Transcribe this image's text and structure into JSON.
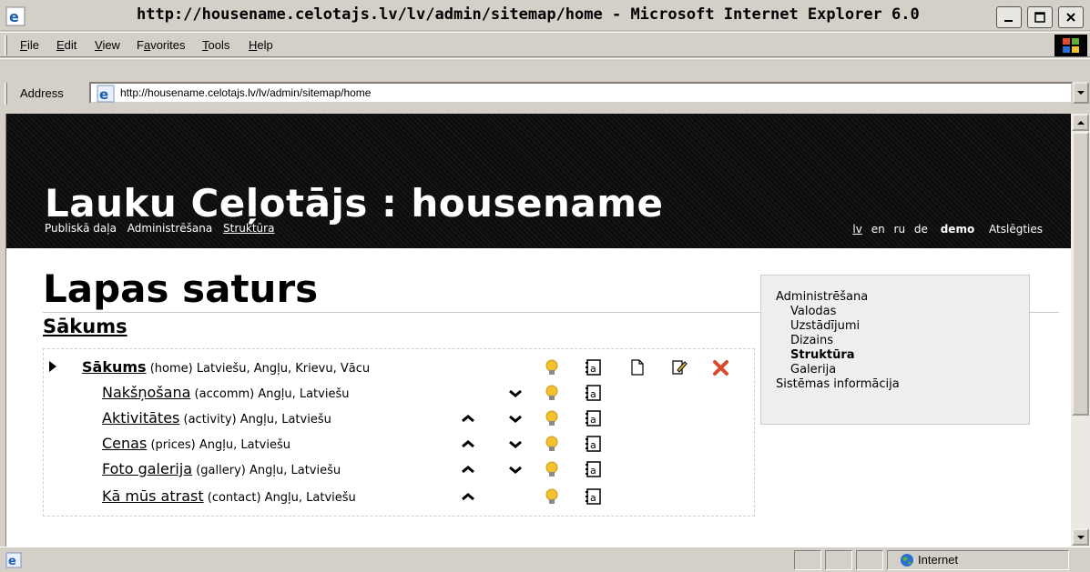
{
  "window": {
    "title": "http://housename.celotajs.lv/lv/admin/sitemap/home - Microsoft Internet Explorer 6.0"
  },
  "menu": {
    "items": [
      {
        "label": "File",
        "ul": "F",
        "rest": "ile"
      },
      {
        "label": "Edit",
        "ul": "E",
        "rest": "dit"
      },
      {
        "label": "View",
        "ul": "V",
        "rest": "iew"
      },
      {
        "label": "Favorites",
        "pre": "F",
        "ul": "a",
        "rest": "vorites"
      },
      {
        "label": "Tools",
        "ul": "T",
        "rest": "ools"
      },
      {
        "label": "Help",
        "ul": "H",
        "rest": "elp"
      }
    ]
  },
  "address": {
    "label": "Address",
    "url": "http://housename.celotajs.lv/lv/admin/sitemap/home"
  },
  "site": {
    "title": "Lauku Ceļotājs : housename",
    "nav": [
      "Publiskā daļa",
      "Administrēšana",
      "Struktūra"
    ],
    "languages": [
      "lv",
      "en",
      "ru",
      "de"
    ],
    "user": "demo",
    "logout": "Atslēgties"
  },
  "page": {
    "heading": "Lapas saturs",
    "section": "Sākums"
  },
  "tree": [
    {
      "title": "Sākums",
      "meta": "(home) Latviešu, Angļu, Krievu, Vācu",
      "root": true
    },
    {
      "title": "Nakšņošana",
      "meta": "(accomm) Angļu, Latviešu"
    },
    {
      "title": "Aktivitātes",
      "meta": "(activity) Angļu, Latviešu"
    },
    {
      "title": "Cenas",
      "meta": "(prices) Angļu, Latviešu"
    },
    {
      "title": "Foto galerija",
      "meta": "(gallery) Angļu, Latviešu"
    },
    {
      "title": "Kā mūs atrast",
      "meta": "(contact) Angļu, Latviešu"
    }
  ],
  "sidebar": {
    "items": [
      "Administrēšana",
      "Valodas",
      "Uzstādījumi",
      "Dizains",
      "Struktūra",
      "Galerija",
      "Sistēmas informācija"
    ]
  },
  "status": {
    "zone": "Internet"
  },
  "icons": {
    "expand": "triangle-right-icon",
    "up": "move-up-icon",
    "down": "move-down-icon",
    "visibility": "lightbulb-icon",
    "content": "content-a-icon",
    "new": "new-page-icon",
    "edit": "edit-icon",
    "delete": "delete-icon"
  },
  "colors": {
    "banner": "#0d0d0d",
    "bulb": "#f2c230",
    "delete": "#d94a2a",
    "chrome": "#d4d0c8"
  }
}
